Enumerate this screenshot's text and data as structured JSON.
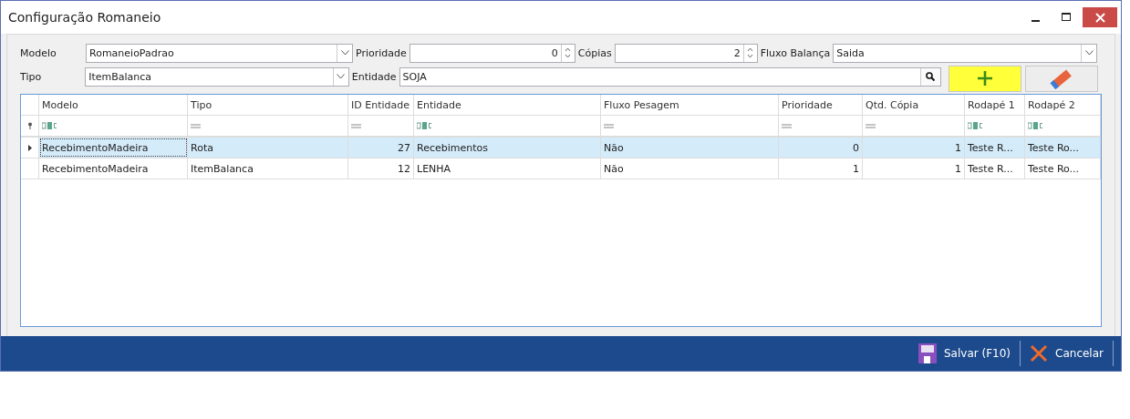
{
  "window": {
    "title": "Configuração Romaneio"
  },
  "form": {
    "modelo": {
      "label": "Modelo",
      "value": "RomaneioPadrao"
    },
    "prioridade": {
      "label": "Prioridade",
      "value": "0"
    },
    "copias": {
      "label": "Cópias",
      "value": "2"
    },
    "fluxo_balanca": {
      "label": "Fluxo Balança",
      "value": "Saida"
    },
    "tipo": {
      "label": "Tipo",
      "value": "ItemBalanca"
    },
    "entidade": {
      "label": "Entidade",
      "value": "SOJA"
    }
  },
  "table": {
    "columns": [
      {
        "label": "Modelo",
        "kind": "contains"
      },
      {
        "label": "Tipo",
        "kind": "equals"
      },
      {
        "label": "ID Entidade",
        "kind": "equals"
      },
      {
        "label": "Entidade",
        "kind": "contains"
      },
      {
        "label": "Fluxo Pesagem",
        "kind": "equals"
      },
      {
        "label": "Prioridade",
        "kind": "equals"
      },
      {
        "label": "Qtd. Cópia",
        "kind": "equals"
      },
      {
        "label": "Rodapé 1",
        "kind": "contains"
      },
      {
        "label": "Rodapé 2",
        "kind": "contains"
      }
    ],
    "rows": [
      {
        "selected": true,
        "cells": [
          "RecebimentoMadeira",
          "Rota",
          "27",
          "Recebimentos",
          "Não",
          "0",
          "1",
          "Teste R...",
          "Teste Ro..."
        ]
      },
      {
        "selected": false,
        "cells": [
          "RecebimentoMadeira",
          "ItemBalanca",
          "12",
          "LENHA",
          "Não",
          "1",
          "1",
          "Teste R...",
          "Teste Ro..."
        ]
      }
    ]
  },
  "buttons": [
    {
      "label": "Salvar (F10)",
      "kind": "save"
    },
    {
      "label": "Cancelar",
      "kind": "cancel"
    }
  ]
}
